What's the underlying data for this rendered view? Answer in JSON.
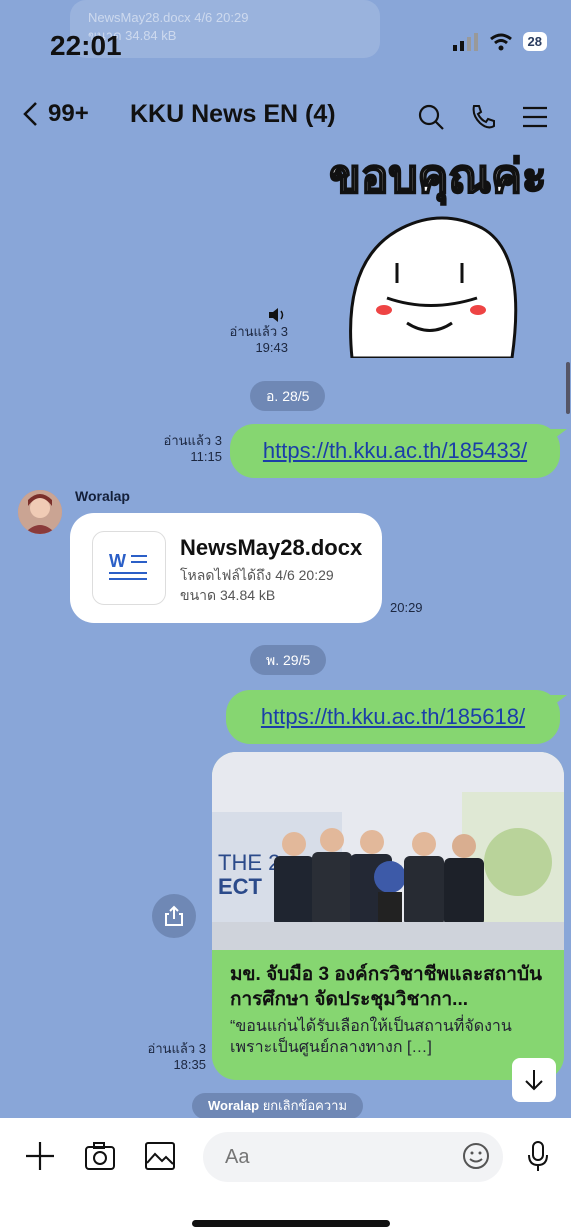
{
  "status_bar": {
    "time": "22:01",
    "battery": "28"
  },
  "notification_ghost": {
    "line1": "NewsMay28.docx 4/6 20:29",
    "line2": "ขนาด 34.84 kB"
  },
  "header": {
    "back_count": "99+",
    "title": "KKU News EN (4)"
  },
  "sticker": {
    "text": "ขอบคุณค่ะ"
  },
  "messages": {
    "sticker_read": "อ่านแล้ว 3",
    "sticker_time": "19:43",
    "day1": "อ. 28/5",
    "link1_read": "อ่านแล้ว 3",
    "link1_time": "11:15",
    "link1": "https://th.kku.ac.th/185433/",
    "sender": "Woralap",
    "file_name": "NewsMay28.docx",
    "file_expiry": "โหลดไฟล์ได้ถึง 4/6 20:29",
    "file_size": "ขนาด 34.84 kB",
    "file_time": "20:29",
    "day2": "พ. 29/5",
    "link2": "https://th.kku.ac.th/185618/",
    "preview_title": "มข. จับมือ 3 องค์กรวิชาชีพและสถาบันการศึกษา จัดประชุมวิชากา...",
    "preview_desc": "“ขอนแก่นได้รับเลือกให้เป็นสถานที่จัดงานเพราะเป็นศูนย์กลางทางก […]",
    "preview_read": "อ่านแล้ว 3",
    "preview_time": "18:35",
    "system_note_name": "Woralap",
    "system_note_text": "ยกเลิกข้อความ"
  },
  "input_bar": {
    "placeholder": "Aa"
  },
  "colors": {
    "chat_bg": "#89a6d8",
    "outgoing": "#86d671",
    "link": "#1b3ea8"
  }
}
